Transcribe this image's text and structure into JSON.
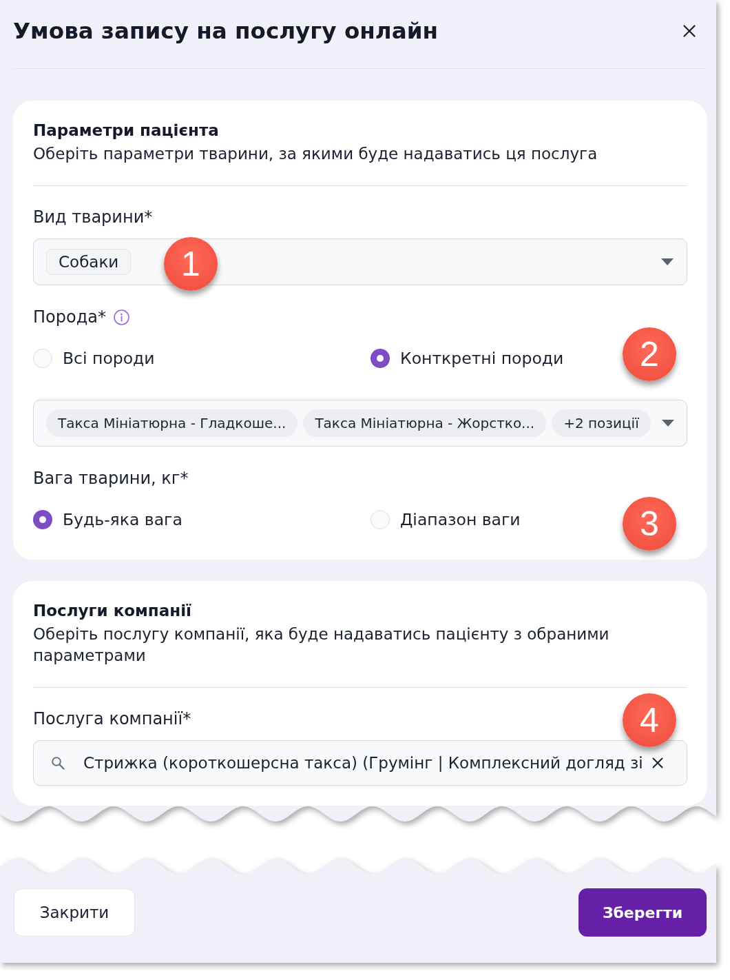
{
  "dialog": {
    "title": "Умова запису на послугу онлайн"
  },
  "sections": [
    {
      "title": "Параметри пацієнта",
      "description": "Оберіть параметри тварини, за якими буде надаватись ця послуга",
      "fields": [
        {
          "kind": "select",
          "label": "Вид тварини*",
          "tags": [
            "Собаки"
          ]
        },
        {
          "kind": "radio_group",
          "label": "Порода*",
          "info": true,
          "options": [
            {
              "label": "Всі породи",
              "selected": false
            },
            {
              "label": "Конткретні породи",
              "selected": true
            }
          ]
        },
        {
          "kind": "multiselect",
          "tags": [
            "Такса Мініатюрна - Гладкоше...",
            "Такса Мініатюрна - Жорстко...",
            "+2 позиції"
          ]
        },
        {
          "kind": "radio_group",
          "label": "Вага тварини, кг*",
          "options": [
            {
              "label": "Будь-яка вага",
              "selected": true
            },
            {
              "label": "Діапазон ваги",
              "selected": false
            }
          ]
        }
      ]
    },
    {
      "title": "Послуги компанії",
      "description": "Оберіть послугу компанії, яка буде надаватись пацієнту з обраними параметрами",
      "fields": [
        {
          "kind": "search",
          "label": "Послуга компанії*",
          "value": "Стрижка (короткошерсна такса) (Грумінг | Комплексний догляд зі"
        }
      ]
    }
  ],
  "footer": {
    "buttons": [
      {
        "label": "Закрити",
        "kind": "secondary"
      },
      {
        "label": "Зберегти",
        "kind": "primary"
      }
    ]
  },
  "callouts": [
    {
      "label": "1"
    },
    {
      "label": "2"
    },
    {
      "label": "3"
    },
    {
      "label": "4"
    }
  ]
}
